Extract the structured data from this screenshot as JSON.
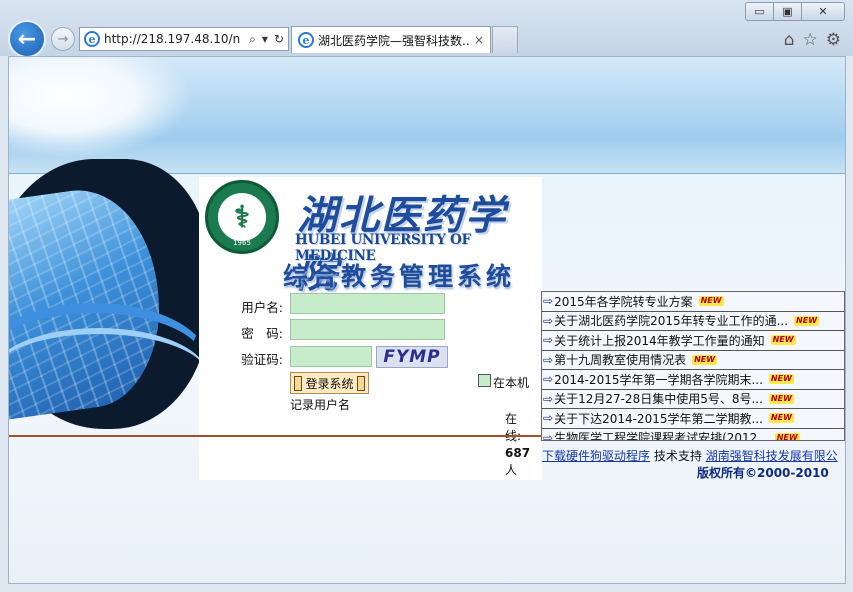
{
  "browser": {
    "address_url": "http://218.197.48.10/n",
    "tab_title": "湖北医药学院—强智科技数...",
    "tab_close": "×",
    "window_minimize": "▭",
    "window_restore": "▣",
    "window_close": "✕",
    "back_icon": "←",
    "forward_icon": "→",
    "search_icon": "⌕",
    "dropdown_icon": "▾",
    "refresh_icon": "↻",
    "home_icon": "⌂",
    "favorites_icon": "☆",
    "settings_icon": "⚙",
    "ie_logo": "e"
  },
  "header": {
    "logo_year": "1965",
    "logo_symbol": "⚕",
    "cn_name": "湖北医药学院",
    "en_name": "HUBEI UNIVERSITY OF MEDICINE",
    "system_name": "综合教务管理系统"
  },
  "login": {
    "username_label": "用户名:",
    "password_label": "密　码:",
    "captcha_label": "验证码:",
    "captcha_text": "FYMP",
    "login_button": "登录系统",
    "remember_label": "记录用户名",
    "local_label": "在本机",
    "online_prefix": "在线:",
    "online_count": "687",
    "online_suffix": "人"
  },
  "news": [
    {
      "text": "2015年各学院转专业方案",
      "badge": "NEW"
    },
    {
      "text": "关于湖北医药学院2015年转专业工作的通...",
      "badge": "NEW"
    },
    {
      "text": "关于统计上报2014年教学工作量的通知",
      "badge": "NEW"
    },
    {
      "text": "第十九周教室使用情况表",
      "badge": "NEW"
    },
    {
      "text": "2014-2015学年第一学期各学院期末...",
      "badge": "NEW"
    },
    {
      "text": "关于12月27-28日集中使用5号、8号...",
      "badge": "NEW"
    },
    {
      "text": "关于下达2014-2015学年第二学期教...",
      "badge": "NEW"
    },
    {
      "text": "生物医学工程学院课程考试安排(2012...",
      "badge": "NEW"
    }
  ],
  "footer": {
    "download_link": "下载硬件狗驱动程序",
    "support_label": "技术支持",
    "company_link": "湖南强智科技发展有限公",
    "copyright": "版权所有©2000-2010"
  },
  "colors": {
    "accent_blue": "#1f4d9b",
    "input_green": "#c6ecc9",
    "new_badge_yellow": "#ffe64a"
  }
}
